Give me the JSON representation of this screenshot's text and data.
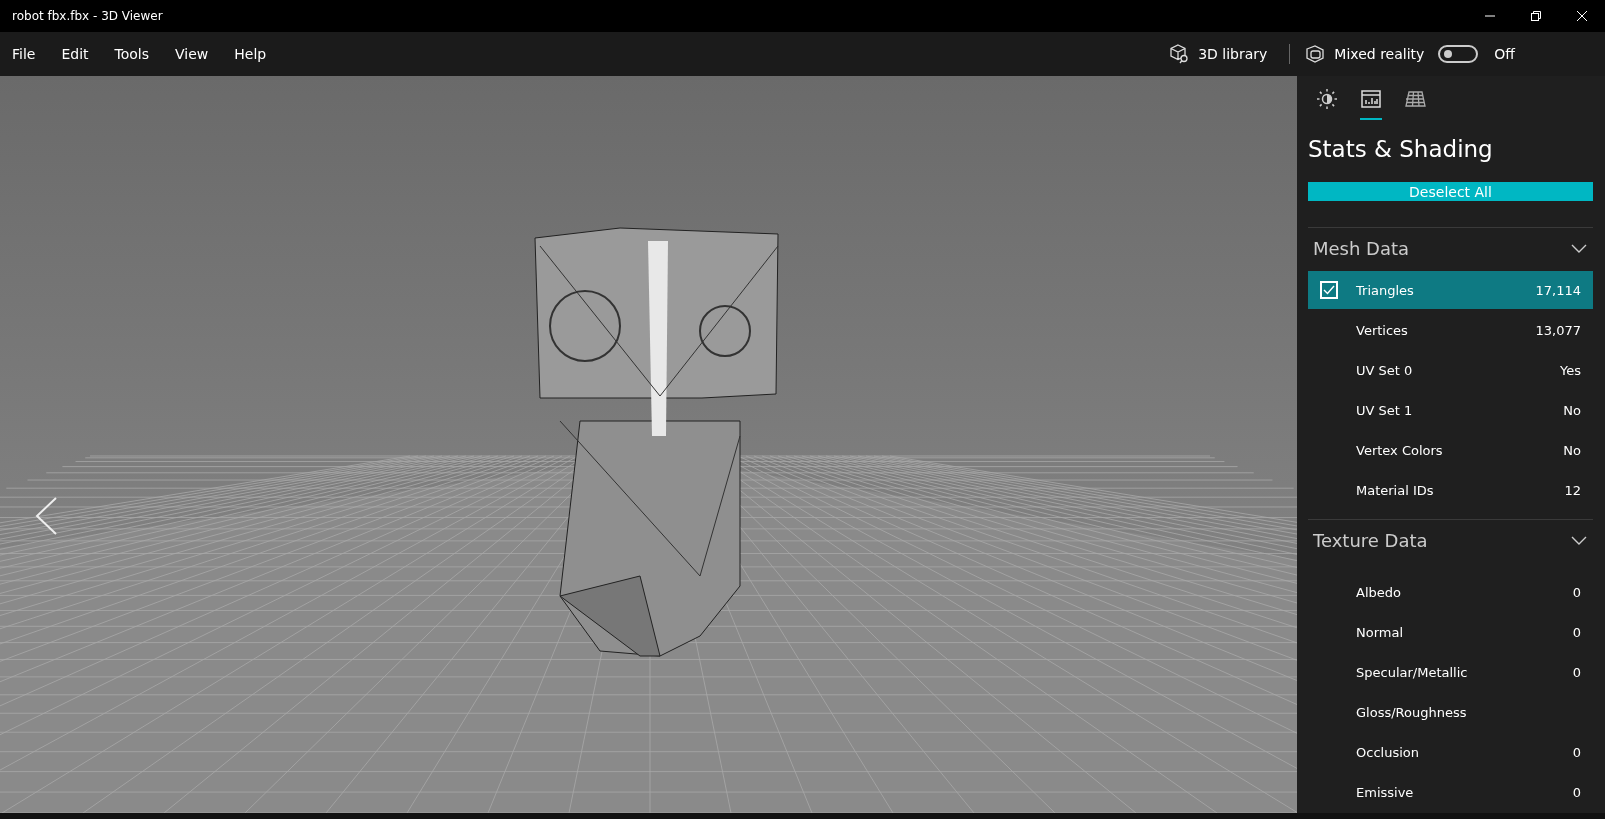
{
  "window": {
    "title": "robot fbx.fbx - 3D Viewer"
  },
  "menu": [
    "File",
    "Edit",
    "Tools",
    "View",
    "Help"
  ],
  "toolbar": {
    "library": "3D library",
    "mixed_reality": {
      "label": "Mixed reality",
      "on": false,
      "state": "Off"
    }
  },
  "viewport": {
    "kind": "picture"
  },
  "panel": {
    "tabs": [
      {
        "kind": "lighting",
        "selected": false
      },
      {
        "kind": "stats",
        "selected": true
      },
      {
        "kind": "grid",
        "selected": false
      }
    ],
    "title": "Stats & Shading",
    "button": "Deselect All",
    "sections": [
      {
        "title": "Mesh Data",
        "expanded": true,
        "rows": [
          {
            "label": "Triangles",
            "value": "17,114",
            "selected": true
          },
          {
            "label": "Vertices",
            "value": "13,077",
            "selected": false
          },
          {
            "label": "UV Set 0",
            "value": "Yes",
            "selected": false
          },
          {
            "label": "UV Set 1",
            "value": "No",
            "selected": false
          },
          {
            "label": "Vertex Colors",
            "value": "No",
            "selected": false
          },
          {
            "label": "Material IDs",
            "value": "12",
            "selected": false
          }
        ]
      },
      {
        "title": "Texture Data",
        "expanded": true,
        "rows": [
          {
            "label": "Albedo",
            "value": "0",
            "selected": false
          },
          {
            "label": "Normal",
            "value": "0",
            "selected": false
          },
          {
            "label": "Specular/Metallic",
            "value": "0",
            "selected": false
          },
          {
            "label": "Gloss/Roughness",
            "selected": false
          },
          {
            "label": "Occlusion",
            "value": "0",
            "selected": false
          },
          {
            "label": "Emissive",
            "value": "0",
            "selected": false
          }
        ]
      }
    ]
  }
}
